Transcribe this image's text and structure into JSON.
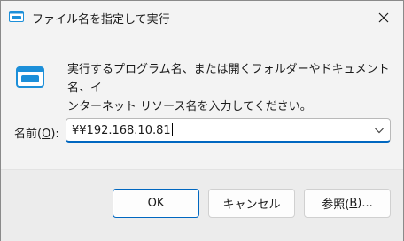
{
  "titlebar": {
    "title": "ファイル名を指定して実行"
  },
  "description": {
    "line1": "実行するプログラム名、または開くフォルダーやドキュメント名、イ",
    "line2": "ンターネット リソース名を入力してください。"
  },
  "open": {
    "label_prefix": "名前(",
    "label_accel": "O",
    "label_suffix": "):",
    "value": "¥¥192.168.10.81"
  },
  "buttons": {
    "ok": "OK",
    "cancel": "キャンセル",
    "browse_prefix": "参照(",
    "browse_accel": "B",
    "browse_suffix": ")..."
  },
  "colors": {
    "accent": "#0067c0",
    "icon_blue": "#1c8fd9"
  }
}
